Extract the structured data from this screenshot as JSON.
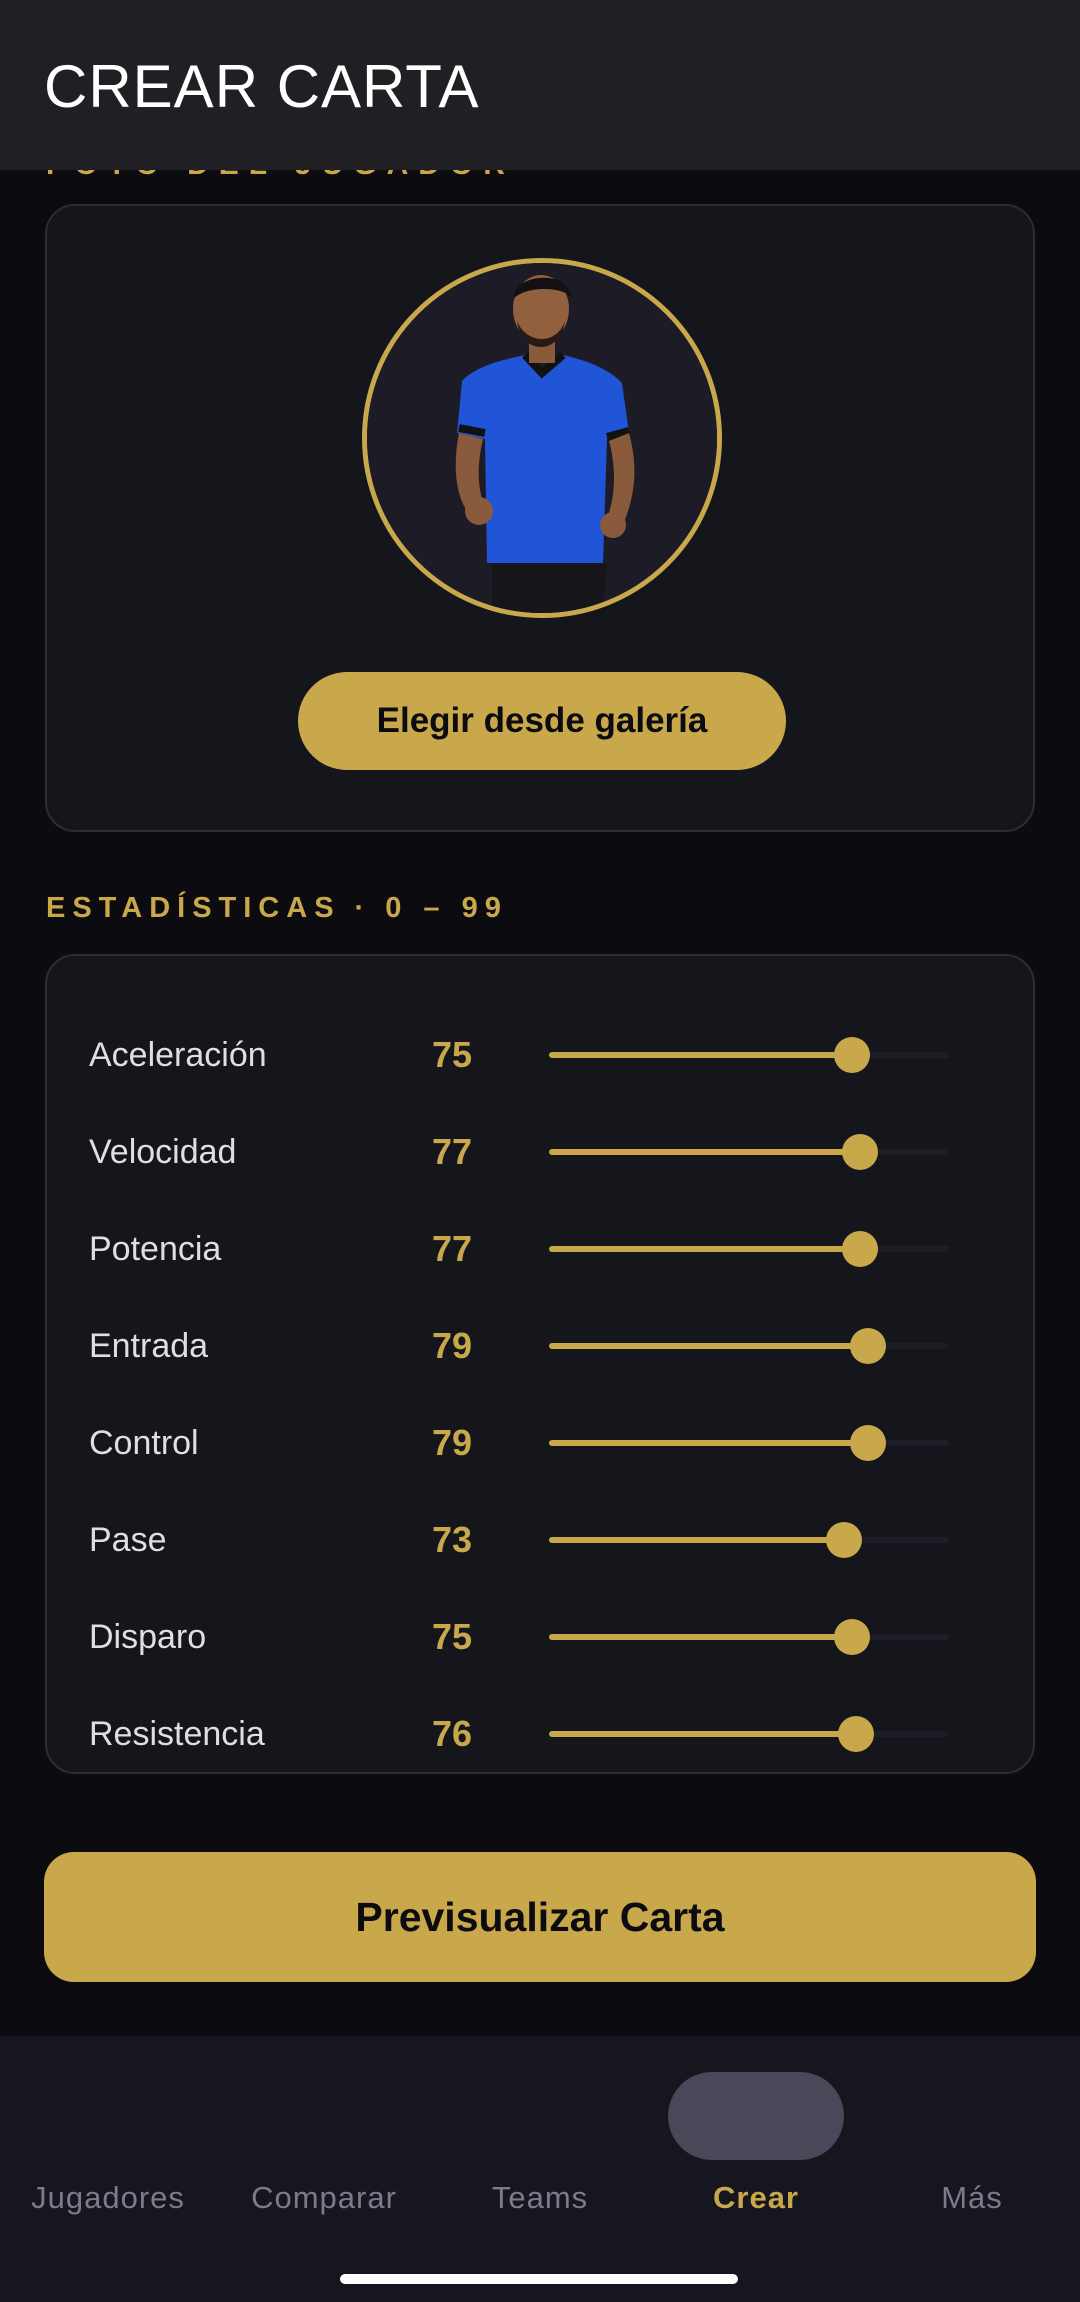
{
  "header": {
    "title": "CREAR CARTA"
  },
  "photo_section": {
    "label": "FOTO DEL JUGADOR",
    "gallery_button": "Elegir desde galería"
  },
  "stats_section": {
    "title": "ESTADÍSTICAS",
    "separator": "·",
    "range": "0 – 99",
    "max": 99,
    "accent_color": "#c9a84c",
    "items": [
      {
        "name": "Aceleración",
        "value": 75
      },
      {
        "name": "Velocidad",
        "value": 77
      },
      {
        "name": "Potencia",
        "value": 77
      },
      {
        "name": "Entrada",
        "value": 79
      },
      {
        "name": "Control",
        "value": 79
      },
      {
        "name": "Pase",
        "value": 73
      },
      {
        "name": "Disparo",
        "value": 75
      },
      {
        "name": "Resistencia",
        "value": 76
      }
    ]
  },
  "preview_button": "Previsualizar Carta",
  "nav": {
    "active": "Crear",
    "items": [
      {
        "label": "Jugadores"
      },
      {
        "label": "Comparar"
      },
      {
        "label": "Teams"
      },
      {
        "label": "Crear"
      },
      {
        "label": "Más"
      }
    ]
  }
}
